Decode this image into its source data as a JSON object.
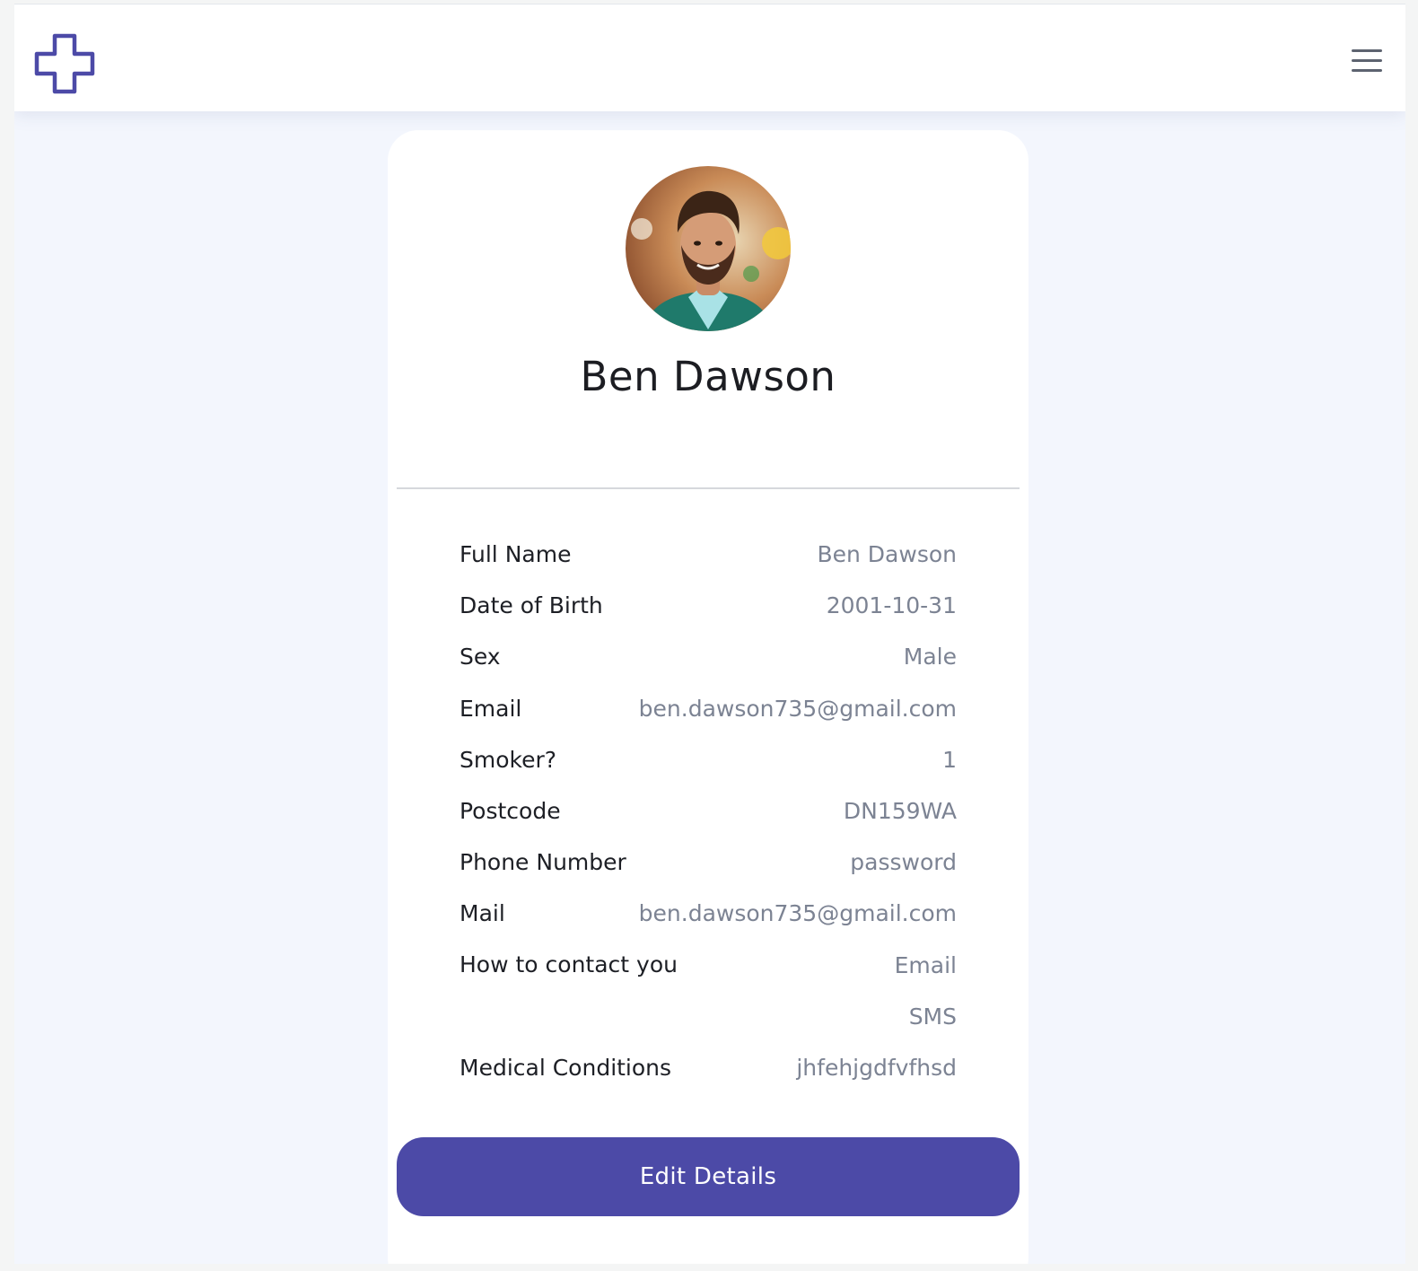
{
  "header": {
    "logo_icon": "medical-cross-logo",
    "menu_icon": "hamburger-menu-icon",
    "brand_color": "#4c4aa7"
  },
  "profile": {
    "avatar": "profile-photo",
    "name": "Ben Dawson"
  },
  "details": {
    "rows": [
      {
        "label": "Full Name",
        "value": "Ben Dawson"
      },
      {
        "label": "Date of Birth",
        "value": "2001-10-31"
      },
      {
        "label": "Sex",
        "value": "Male"
      },
      {
        "label": "Email",
        "value": "ben.dawson735@gmail.com"
      },
      {
        "label": "Smoker?",
        "value": "1"
      },
      {
        "label": "Postcode",
        "value": "DN159WA"
      },
      {
        "label": "Phone Number",
        "value": "password"
      },
      {
        "label": "Mail",
        "value": "ben.dawson735@gmail.com"
      }
    ],
    "contact": {
      "label": "How to contact you",
      "values": [
        "Email",
        "SMS"
      ]
    },
    "medical": {
      "label": "Medical Conditions",
      "value": "jhfehjgdfvfhsd"
    }
  },
  "actions": {
    "edit_label": "Edit Details"
  }
}
